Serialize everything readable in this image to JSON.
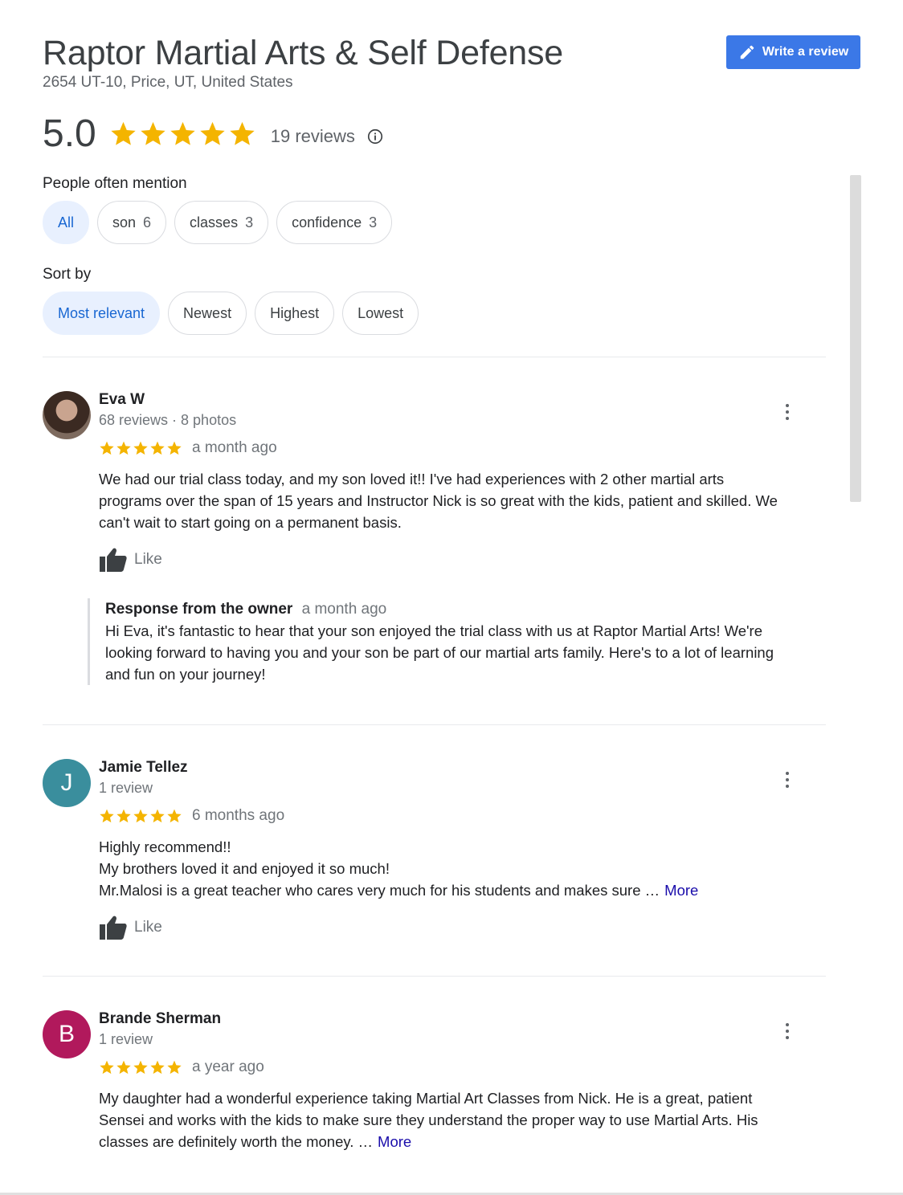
{
  "header": {
    "title": "Raptor Martial Arts & Self Defense",
    "address": "2654 UT-10, Price, UT, United States",
    "write_review_label": "Write a review"
  },
  "summary": {
    "rating": "5.0",
    "stars": 5,
    "reviews_count": "19 reviews",
    "info_icon": "info-icon"
  },
  "mentions": {
    "label": "People often mention",
    "chips": [
      {
        "label": "All",
        "count": ""
      },
      {
        "label": "son",
        "count": "6"
      },
      {
        "label": "classes",
        "count": "3"
      },
      {
        "label": "confidence",
        "count": "3"
      }
    ]
  },
  "sort": {
    "label": "Sort by",
    "options": [
      "Most relevant",
      "Newest",
      "Highest",
      "Lowest"
    ]
  },
  "reviews": [
    {
      "name": "Eva W",
      "meta": "68 reviews · 8 photos",
      "avatar_letter": "",
      "stars": 5,
      "time": "a month ago",
      "text_lines": [
        "We had our trial class today, and my son loved it!! I've had experiences with 2 other martial arts",
        "programs over the span of 15 years and Instructor Nick is so great with the kids, patient and skilled. We",
        "can't wait to start going on a permanent basis."
      ],
      "like_label": "Like",
      "owner_response": {
        "heading": "Response from the owner",
        "time": "a month ago",
        "text_lines": [
          "Hi Eva, it's fantastic to hear that your son enjoyed the trial class with us at Raptor Martial Arts! We're",
          "looking forward to having you and your son be part of our martial arts family. Here's to a lot of learning",
          "and fun on your journey!"
        ]
      }
    },
    {
      "name": "Jamie Tellez",
      "meta": "1 review",
      "avatar_letter": "J",
      "stars": 5,
      "time": "6 months ago",
      "text_lines": [
        "Highly recommend!!",
        "My brothers loved it and enjoyed it so much!",
        "Mr.Malosi is a great teacher who cares very much for his students and makes sure …"
      ],
      "more_label": "More",
      "like_label": "Like"
    },
    {
      "name": "Brande Sherman",
      "meta": "1 review",
      "avatar_letter": "B",
      "stars": 5,
      "time": "a year ago",
      "text_lines": [
        "My daughter had a wonderful experience taking Martial Art Classes from Nick. He is a great, patient",
        "Sensei and works with the kids to make sure they understand the proper way to use Martial Arts. His",
        "classes are definitely worth the money. …"
      ],
      "more_label": "More"
    }
  ],
  "colors": {
    "star": "#f4b400",
    "accent": "#3b78e7",
    "link": "#1a0dab",
    "chip_active_bg": "#e8f0fe"
  }
}
